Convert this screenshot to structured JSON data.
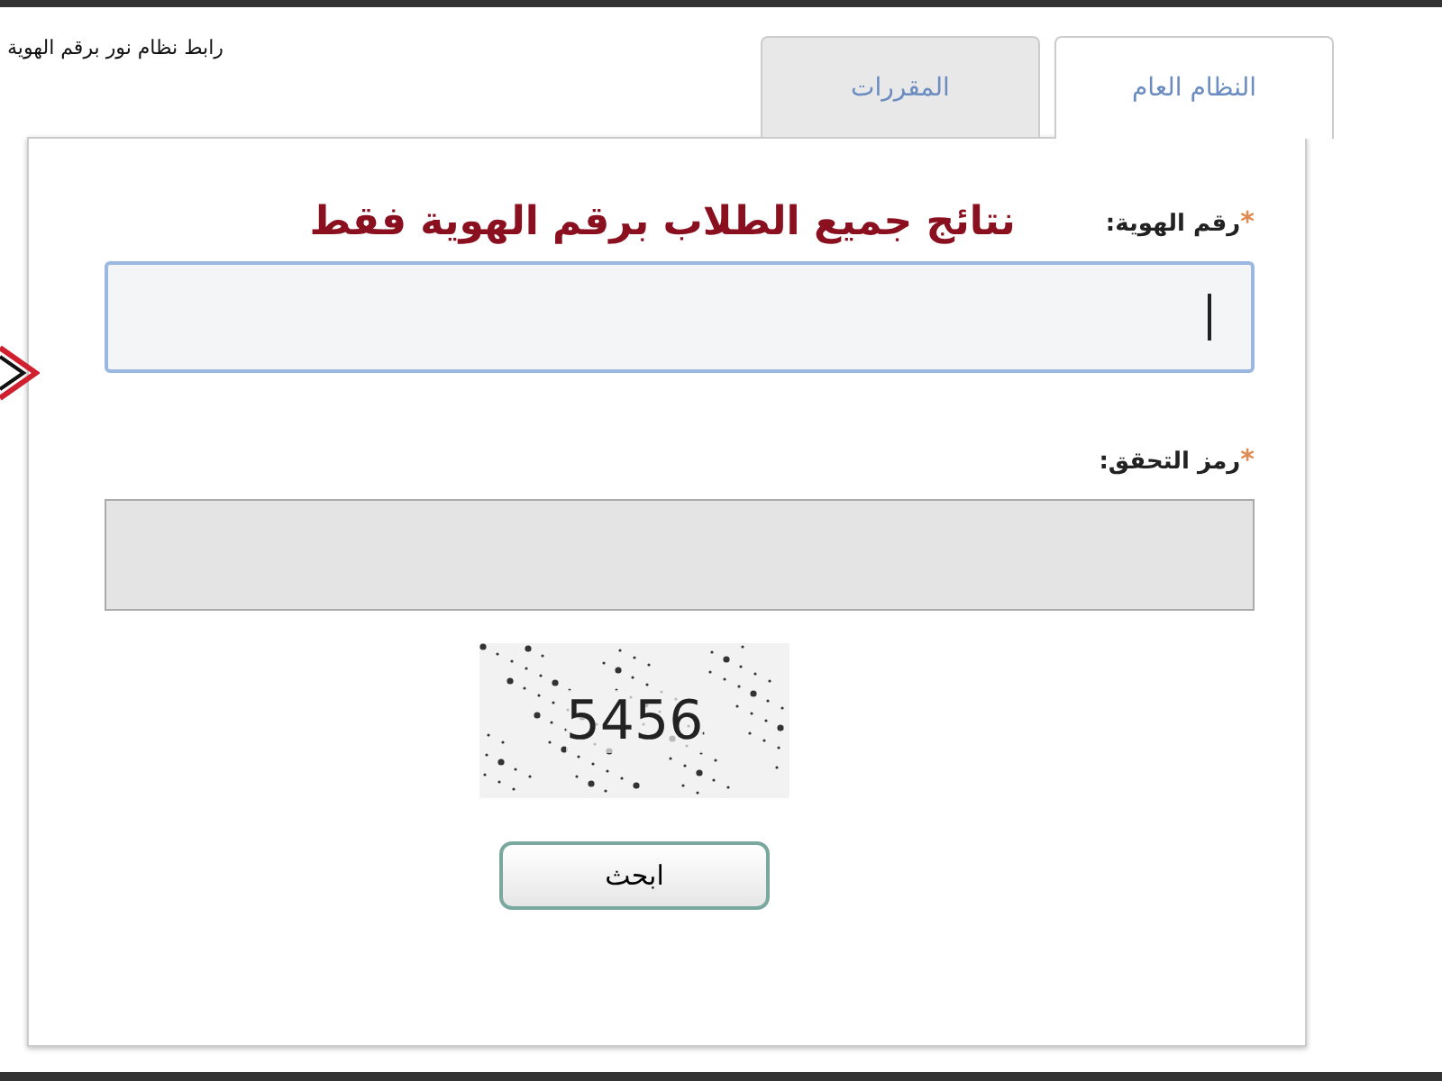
{
  "caption": "رابط نظام نور برقم الهوية",
  "tabs": [
    {
      "label": "النظام العام",
      "selected": true
    },
    {
      "label": "المقررات",
      "selected": false
    }
  ],
  "heading": "نتائج جميع الطلاب برقم الهوية فقط",
  "fields": [
    {
      "mark": "*",
      "label": "رقم الهوية:",
      "focused": true
    },
    {
      "mark": "*",
      "label": "رمز التحقق:",
      "focused": false
    }
  ],
  "captcha": "5456",
  "button": "ابحث"
}
